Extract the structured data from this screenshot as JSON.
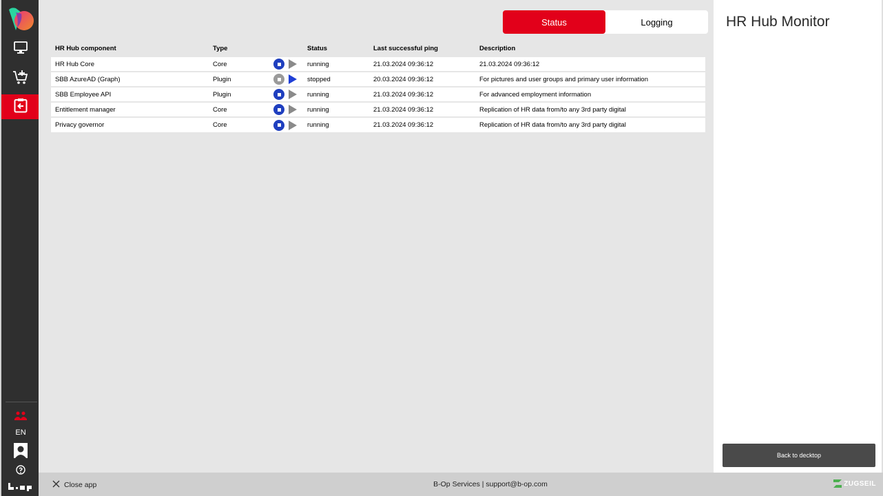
{
  "sidebar": {
    "icons": [
      "app-logo",
      "desktop-icon",
      "add-to-cart-icon",
      "clipboard-back-icon",
      "team-icon",
      "user-icon",
      "help-icon"
    ],
    "language": "EN",
    "brand": "b·op"
  },
  "tabs": [
    {
      "label": "Status",
      "active": true
    },
    {
      "label": "Logging",
      "active": false
    }
  ],
  "table": {
    "headers": [
      "HR Hub component",
      "Type",
      "",
      "Status",
      "Last successful ping",
      "Description"
    ],
    "rows": [
      {
        "component": "HR Hub Core",
        "type": "Core",
        "status": "running",
        "ping": "21.03.2024 09:36:12",
        "description": "21.03.2024 09:36:12"
      },
      {
        "component": "SBB AzureAD (Graph)",
        "type": "Plugin",
        "status": "stopped",
        "ping": "20.03.2024 09:36:12",
        "description": "For pictures and user groups and primary user information"
      },
      {
        "component": "SBB Employee API",
        "type": "Plugin",
        "status": "running",
        "ping": "21.03.2024 09:36:12",
        "description": "For advanced employment information"
      },
      {
        "component": "Entitlement manager",
        "type": "Core",
        "status": "running",
        "ping": "21.03.2024 09:36:12",
        "description": "Replication of HR data from/to any 3rd party digital"
      },
      {
        "component": "Privacy governor",
        "type": "Core",
        "status": "running",
        "ping": "21.03.2024 09:36:12",
        "description": "Replication of HR data from/to any 3rd party digital"
      }
    ]
  },
  "panel": {
    "title": "HR Hub Monitor",
    "back_label": "Back to decktop"
  },
  "footer": {
    "close_label": "Close app",
    "support": "B-Op Services | support@b-op.com",
    "brand": "ZUGSEIL"
  },
  "colors": {
    "accent": "#e2001a",
    "control_blue": "#1f3fbf",
    "sidebar": "#2f2f2f"
  }
}
